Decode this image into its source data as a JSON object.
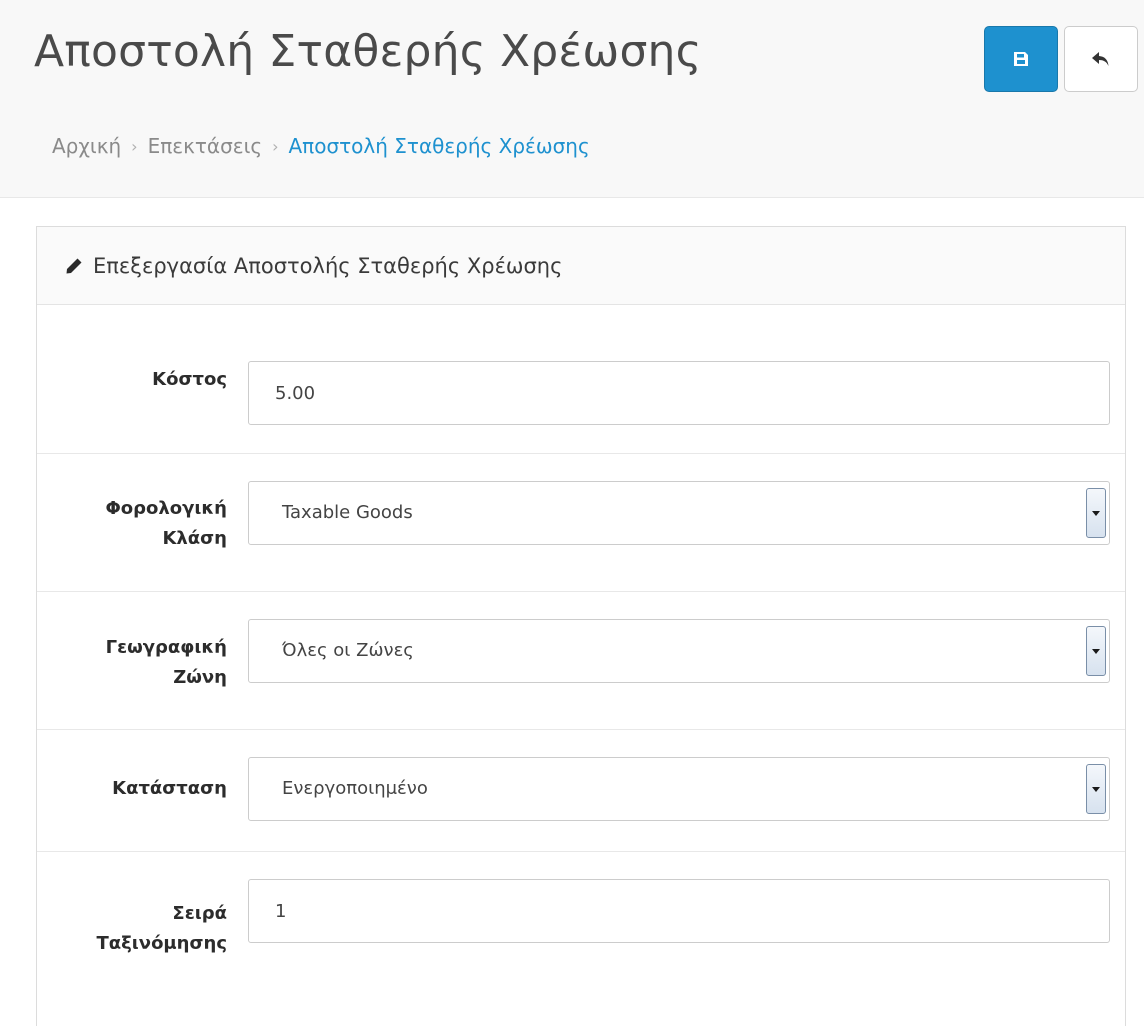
{
  "header": {
    "title": "Αποστολή Σταθερής Χρέωσης",
    "save_icon": "save-icon",
    "back_icon": "reply-icon"
  },
  "breadcrumb": [
    {
      "label": "Αρχική"
    },
    {
      "label": "Επεκτάσεις"
    },
    {
      "label": "Αποστολή Σταθερής Χρέωσης"
    }
  ],
  "panel": {
    "icon": "pencil-icon",
    "title": "Επεξεργασία Αποστολής Σταθερής Χρέωσης"
  },
  "form": {
    "cost": {
      "label": "Κόστος",
      "value": "5.00"
    },
    "tax_class": {
      "label_line1": "Φορολογική",
      "label_line2": "Κλάση",
      "value": "Taxable Goods"
    },
    "geo_zone": {
      "label_line1": "Γεωγραφική",
      "label_line2": "Ζώνη",
      "value": "Όλες οι Ζώνες"
    },
    "status": {
      "label": "Κατάσταση",
      "value": "Ενεργοποιημένο"
    },
    "sort_order": {
      "label_line1": "Σειρά",
      "label_line2": "Ταξινόμησης",
      "value": "1"
    }
  },
  "colors": {
    "primary": "#1e91cf",
    "header_bg": "#f8f8f8"
  }
}
